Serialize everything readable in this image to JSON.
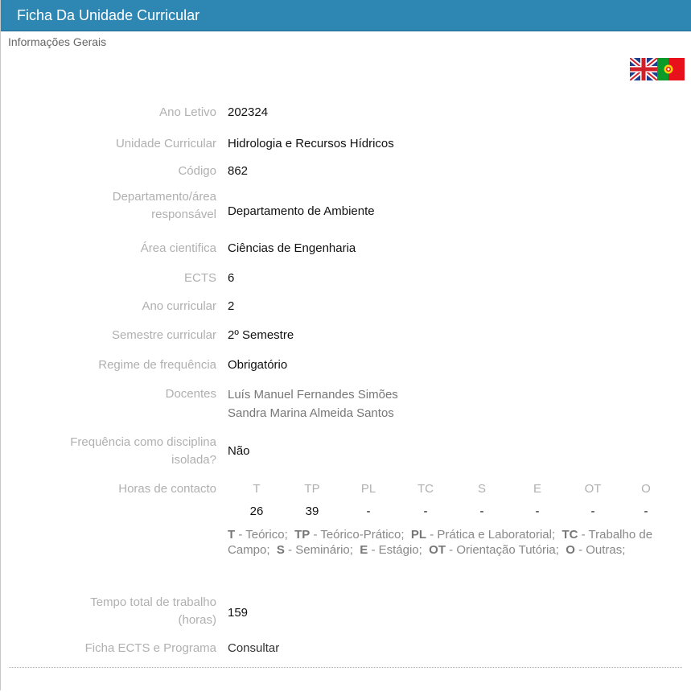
{
  "header": {
    "title": "Ficha Da Unidade Curricular"
  },
  "section": {
    "title": "Informações Gerais"
  },
  "languages": [
    {
      "name": "English",
      "icon": "uk-flag-icon"
    },
    {
      "name": "Português",
      "icon": "portugal-flag-icon"
    }
  ],
  "fields": {
    "ano_letivo": {
      "label": "Ano Letivo",
      "value": "202324"
    },
    "unidade": {
      "label": "Unidade Curricular",
      "value": "Hidrologia e Recursos Hídricos"
    },
    "codigo": {
      "label": "Código",
      "value": "862"
    },
    "departamento": {
      "label_line1": "Departamento/área",
      "label_line2": "responsável",
      "value": "Departamento de Ambiente"
    },
    "area": {
      "label": "Área cientifica",
      "value": "Ciências de Engenharia"
    },
    "ects": {
      "label": "ECTS",
      "value": "6"
    },
    "ano_curricular": {
      "label": "Ano curricular",
      "value": "2"
    },
    "semestre": {
      "label": "Semestre curricular",
      "value": "2º Semestre"
    },
    "regime": {
      "label": "Regime de frequência",
      "value": "Obrigatório"
    },
    "docentes": {
      "label": "Docentes",
      "values": [
        "Luís Manuel Fernandes Simões",
        "Sandra Marina Almeida Santos"
      ]
    },
    "isolada": {
      "label_line1": "Frequência como disciplina",
      "label_line2": "isolada?",
      "value": "Não"
    },
    "horas": {
      "label": "Horas de contacto",
      "columns": [
        {
          "code": "T",
          "value": "26"
        },
        {
          "code": "TP",
          "value": "39"
        },
        {
          "code": "PL",
          "value": "-"
        },
        {
          "code": "TC",
          "value": "-"
        },
        {
          "code": "S",
          "value": "-"
        },
        {
          "code": "E",
          "value": "-"
        },
        {
          "code": "OT",
          "value": "-"
        },
        {
          "code": "O",
          "value": "-"
        }
      ],
      "legend": [
        {
          "code": "T",
          "text": " - Teórico;"
        },
        {
          "code": "TP",
          "text": " - Teórico-Prático;"
        },
        {
          "code": "PL",
          "text": " - Prática e Laboratorial;"
        },
        {
          "code": "TC",
          "text": " - Trabalho de Campo;"
        },
        {
          "code": "S",
          "text": " - Seminário;"
        },
        {
          "code": "E",
          "text": " - Estágio;"
        },
        {
          "code": "OT",
          "text": " - Orientação Tutória;"
        },
        {
          "code": "O",
          "text": " - Outras;"
        }
      ]
    },
    "tempo_total": {
      "label_line1": "Tempo total de trabalho",
      "label_line2": "(horas)",
      "value": "159"
    },
    "ficha": {
      "label": "Ficha ECTS e Programa",
      "value": "Consultar"
    }
  }
}
